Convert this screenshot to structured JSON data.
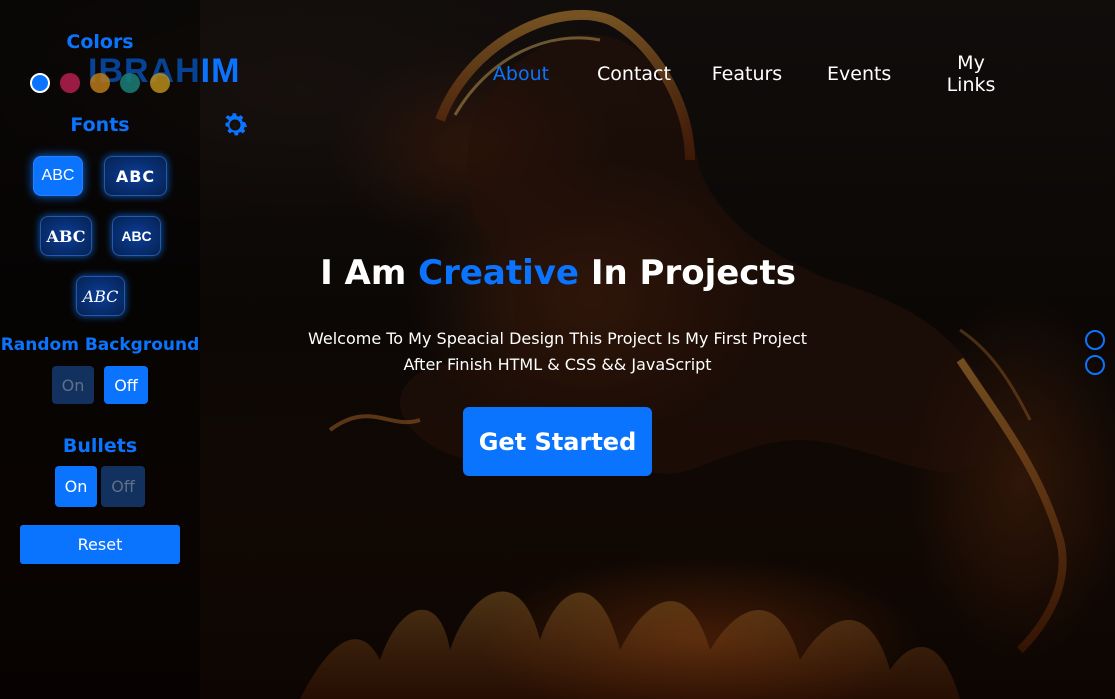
{
  "brand": {
    "logo": "IBRAHIM"
  },
  "nav": {
    "items": [
      "About",
      "Contact",
      "Featurs",
      "Events",
      "My Links"
    ],
    "active": "About"
  },
  "hero": {
    "title_part1": "I Am ",
    "title_highlight": "Creative",
    "title_part2": " In Projects",
    "line1": "Welcome To My Speacial Design This Project Is My First Project",
    "line2": "After Finish HTML & CSS && JavaScript",
    "cta": "Get Started"
  },
  "settings": {
    "colors_title": "Colors",
    "colors": [
      "#0b74ff",
      "#9b1b45",
      "#b97a1b",
      "#1b7f78",
      "#b88c1b"
    ],
    "selected_color": "#0b74ff",
    "fonts_title": "Fonts",
    "font_label": "ABC",
    "random_bg_title": "Random Background",
    "random_bg_on": "On",
    "random_bg_off": "Off",
    "random_bg_state": "Off",
    "bullets_title": "Bullets",
    "bullets_on": "On",
    "bullets_off": "Off",
    "bullets_state": "On",
    "reset": "Reset"
  },
  "bullets_count": 2,
  "icons": {
    "gear": "gear-icon"
  },
  "accent": "#0b74ff"
}
